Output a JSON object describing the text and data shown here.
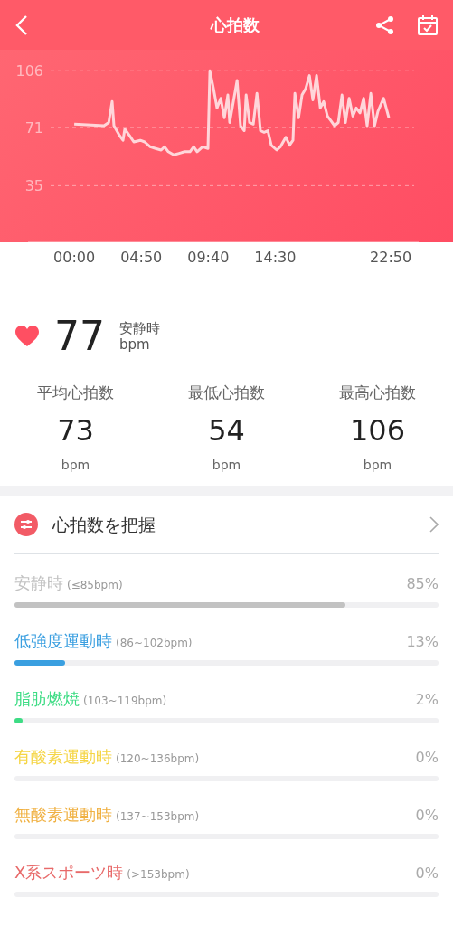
{
  "header": {
    "title": "心拍数"
  },
  "heart_rate_chart": {
    "chart_data": {
      "type": "line",
      "x": [
        0,
        129,
        149,
        164,
        172,
        196,
        211,
        219,
        239,
        258,
        286,
        305,
        329,
        352,
        376,
        391,
        407,
        431,
        454,
        478,
        501,
        517,
        532,
        556,
        579,
        587,
        603,
        618,
        634,
        650,
        665,
        673,
        689,
        705,
        720,
        736,
        744,
        759,
        775,
        791,
        806,
        822,
        838,
        853,
        877,
        892,
        916,
        932,
        947,
        955,
        971,
        986,
        1002,
        1018,
        1033,
        1049,
        1065,
        1080,
        1096,
        1112,
        1127,
        1143,
        1159,
        1174,
        1190,
        1206,
        1221,
        1237,
        1253,
        1268,
        1284,
        1300,
        1315,
        1339,
        1362
      ],
      "series": [
        {
          "color": "#ffd6da",
          "values": [
            73,
            72,
            74,
            87,
            72,
            66,
            63,
            70,
            66,
            62,
            63,
            62,
            59,
            58,
            57,
            59,
            56,
            54,
            55,
            56,
            56,
            59,
            56,
            59,
            58,
            106,
            95,
            83,
            89,
            77,
            91,
            74,
            87,
            100,
            72,
            69,
            91,
            74,
            73,
            92,
            69,
            68,
            69,
            60,
            57,
            59,
            65,
            60,
            63,
            92,
            77,
            91,
            95,
            103,
            88,
            103,
            83,
            87,
            78,
            75,
            72,
            74,
            91,
            74,
            89,
            78,
            83,
            80,
            89,
            72,
            92,
            72,
            81,
            89,
            77
          ]
        }
      ],
      "xlim": [
        -200,
        1491
      ],
      "ylim": [
        0,
        119
      ],
      "grid": true,
      "xticks": [
        {
          "value": 0,
          "label": "00:00"
        },
        {
          "value": 290,
          "label": "04:50"
        },
        {
          "value": 580,
          "label": "09:40"
        },
        {
          "value": 870,
          "label": "14:30"
        },
        {
          "value": 1370,
          "label": "22:50"
        }
      ],
      "yticks": [
        35,
        71,
        106
      ]
    }
  },
  "current": {
    "value": "77",
    "label": "安静時",
    "unit": "bpm"
  },
  "stats": [
    {
      "label": "平均心拍数",
      "value": "73",
      "unit": "bpm"
    },
    {
      "label": "最低心拍数",
      "value": "54",
      "unit": "bpm"
    },
    {
      "label": "最高心拍数",
      "value": "106",
      "unit": "bpm"
    }
  ],
  "zones_card": {
    "title": "心拍数を把握",
    "zones": [
      {
        "name": "安静時",
        "range": "(≤85bpm)",
        "percent": "85%",
        "level": 0.78,
        "color": "#c2c2c2"
      },
      {
        "name": "低強度運動時",
        "range": "(86~102bpm)",
        "percent": "13%",
        "level": 0.12,
        "color": "#3a9fe0"
      },
      {
        "name": "脂肪燃焼",
        "range": "(103~119bpm)",
        "percent": "2%",
        "level": 0.02,
        "color": "#3ddc84"
      },
      {
        "name": "有酸素運動時",
        "range": "(120~136bpm)",
        "percent": "0%",
        "color": "#f5d545"
      },
      {
        "name": "無酸素運動時",
        "range": "(137~153bpm)",
        "percent": "0%",
        "color": "#f0b040"
      },
      {
        "name": "X系スポーツ時",
        "range": "(>153bpm)",
        "percent": "0%",
        "color": "#e86a6a"
      }
    ]
  }
}
